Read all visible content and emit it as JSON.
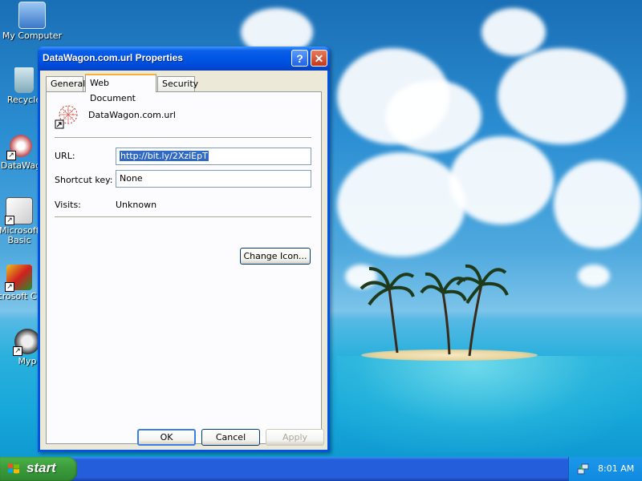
{
  "desktop": {
    "icons": [
      {
        "label": "My Computer"
      },
      {
        "label": "Recycle"
      },
      {
        "label": "DataWag"
      },
      {
        "label": "Microsoft Basic"
      },
      {
        "label": "Microsoft C++"
      },
      {
        "label": "Myp"
      }
    ]
  },
  "window": {
    "title": "DataWagon.com.url Properties",
    "help_label": "?",
    "close_label": "✕",
    "tabs": [
      {
        "label": "General"
      },
      {
        "label": "Web Document"
      },
      {
        "label": "Security"
      }
    ],
    "active_tab": "Web Document",
    "file_name": "DataWagon.com.url",
    "url_label": "URL:",
    "url_value": "http://bit.ly/2XziEpT",
    "shortcut_label": "Shortcut key:",
    "shortcut_value": "None",
    "visits_label": "Visits:",
    "visits_value": "Unknown",
    "change_icon_label": "Change Icon...",
    "ok_label": "OK",
    "cancel_label": "Cancel",
    "apply_label": "Apply"
  },
  "taskbar": {
    "start_label": "start",
    "clock": "8:01 AM"
  },
  "colors": {
    "title_bar": "#0054e3",
    "dialog_bg": "#ece9d8",
    "taskbar": "#245edb",
    "start_button": "#3c9a3c"
  }
}
